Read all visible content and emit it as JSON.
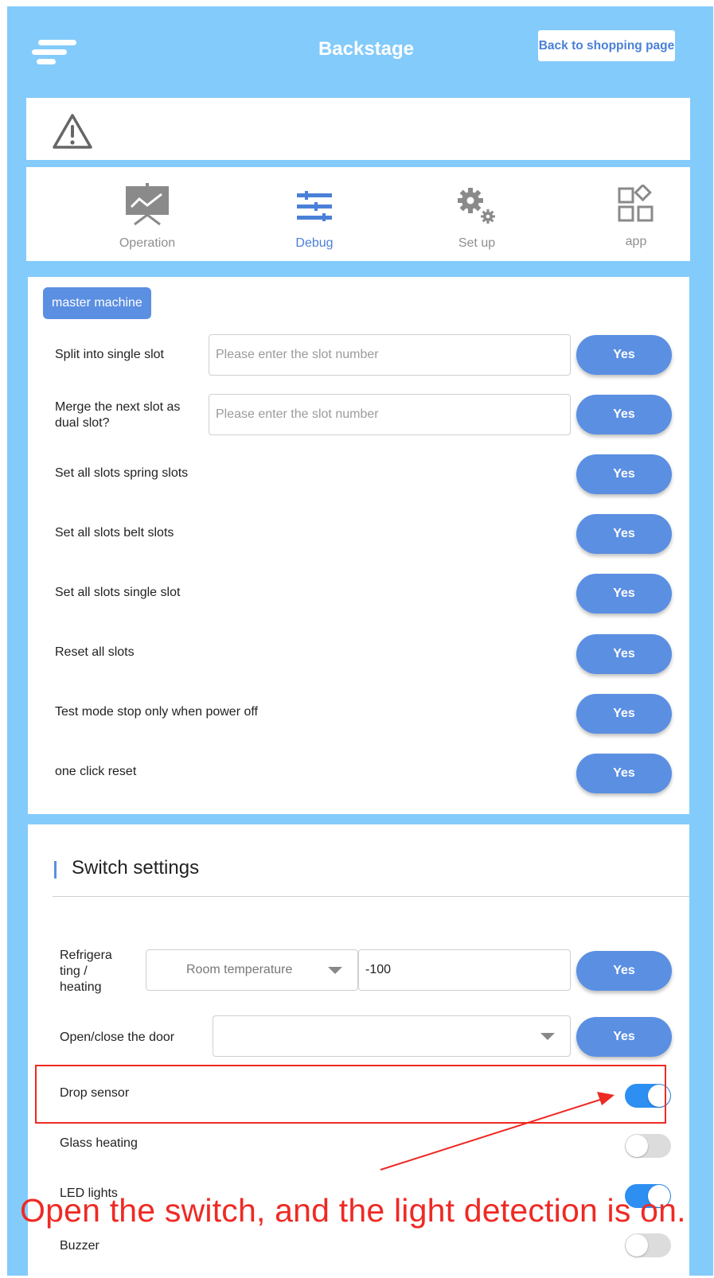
{
  "header": {
    "title": "Backstage",
    "back_button": "Back to shopping page"
  },
  "nav": {
    "tabs": [
      {
        "label": "Operation",
        "icon": "presentation-chart-icon",
        "active": false
      },
      {
        "label": "Debug",
        "icon": "sliders-icon",
        "active": true
      },
      {
        "label": "Set up",
        "icon": "gears-icon",
        "active": false
      },
      {
        "label": "app",
        "icon": "apps-grid-icon",
        "active": false
      }
    ]
  },
  "debug": {
    "machine_chip": "master machine",
    "yes_label": "Yes",
    "split_label": "Split into single slot",
    "split_placeholder": "Please enter the slot number",
    "merge_label": "Merge the next slot as dual slot?",
    "merge_placeholder": "Please enter the slot number",
    "spring_label": "Set all slots spring slots",
    "belt_label": "Set all slots belt slots",
    "single_label": "Set all slots single slot",
    "reset_label": "Reset all slots",
    "testmode_label": "Test mode stop only when power off",
    "oneclick_label": "one click reset"
  },
  "switch_settings": {
    "title": "Switch settings",
    "refrigeration_label": "Refrigera ting / heating",
    "refrigeration_mode": "Room temperature",
    "refrigeration_value": "-100",
    "door_label": "Open/close the door",
    "door_value": "",
    "yes_label": "Yes",
    "toggles": [
      {
        "label": "Drop sensor",
        "on": true
      },
      {
        "label": "Glass heating",
        "on": false
      },
      {
        "label": "LED lights",
        "on": true
      },
      {
        "label": "Buzzer",
        "on": false
      }
    ]
  },
  "annotation": {
    "text": "Open the switch, and the light detection is on."
  },
  "colors": {
    "background": "#83cbfb",
    "accent": "#5b8fe2",
    "toggle_on": "#2d8ff2",
    "annotation": "#ee2a24"
  }
}
